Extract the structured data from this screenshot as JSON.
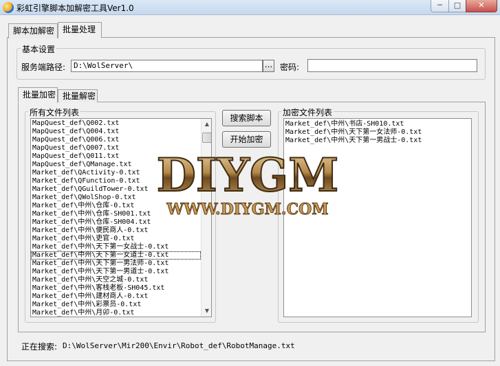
{
  "window": {
    "title": "彩虹引擎脚本加解密工具Ver1.0",
    "min": "─",
    "max": "□",
    "close": "✕"
  },
  "tabs": [
    {
      "label": "脚本加解密"
    },
    {
      "label": "批量处理"
    }
  ],
  "basic": {
    "legend": "基本设置",
    "server_path_label": "服务端路径:",
    "server_path_value": "D:\\WolServer\\",
    "browse": "...",
    "password_label": "密码:",
    "password_value": ""
  },
  "subtabs": [
    {
      "label": "批量加密"
    },
    {
      "label": "批量解密"
    }
  ],
  "all_files": {
    "legend": "所有文件列表",
    "items": [
      "MapQuest_def\\Q002.txt",
      "MapQuest_def\\Q004.txt",
      "MapQuest_def\\Q006.txt",
      "MapQuest_def\\Q007.txt",
      "MapQuest_def\\Q011.txt",
      "MapQuest_def\\QManage.txt",
      "Market_def\\QActivity-0.txt",
      "Market_def\\QFunction-0.txt",
      "Market_def\\QGuildTower-0.txt",
      "Market_def\\QWolShop-0.txt",
      "Market_def\\中州\\仓库-0.txt",
      "Market_def\\中州\\仓库-SH001.txt",
      "Market_def\\中州\\仓库-SH004.txt",
      "Market_def\\中州\\便民商人-0.txt",
      "Market_def\\中州\\吏官-0.txt",
      "Market_def\\中州\\天下第一女战士-0.txt",
      "Market_def\\中州\\天下第一女道士-0.txt",
      "Market_def\\中州\\天下第一男法师-0.txt",
      "Market_def\\中州\\天下第一男道士-0.txt",
      "Market_def\\中州\\天空之城-0.txt",
      "Market_def\\中州\\客栈老板-SH045.txt",
      "Market_def\\中州\\建材商人-0.txt",
      "Market_def\\中州\\彩票员-0.txt",
      "Market_def\\中州\\月卯-0.txt"
    ],
    "scroll_up": "▲",
    "scroll_down": "▼"
  },
  "buttons": {
    "search": "搜索脚本",
    "encrypt": "开始加密"
  },
  "encrypted_files": {
    "legend": "加密文件列表",
    "items": [
      "Market_def\\中州\\书店-SH010.txt",
      "Market_def\\中州\\天下第一女法师-0.txt",
      "Market_def\\中州\\天下第一男战士-0.txt"
    ]
  },
  "status": {
    "label": "正在搜索:",
    "path": "D:\\WolServer\\Mir200\\Envir\\Robot_def\\RobotManage.txt"
  },
  "watermark": {
    "brand": "DIYGM",
    "url": "WWW.DIYGM.COM"
  },
  "colors": {
    "close": "#c75050",
    "titlebar": "#c6d8ee",
    "watermark_gold": "#b5894a"
  }
}
